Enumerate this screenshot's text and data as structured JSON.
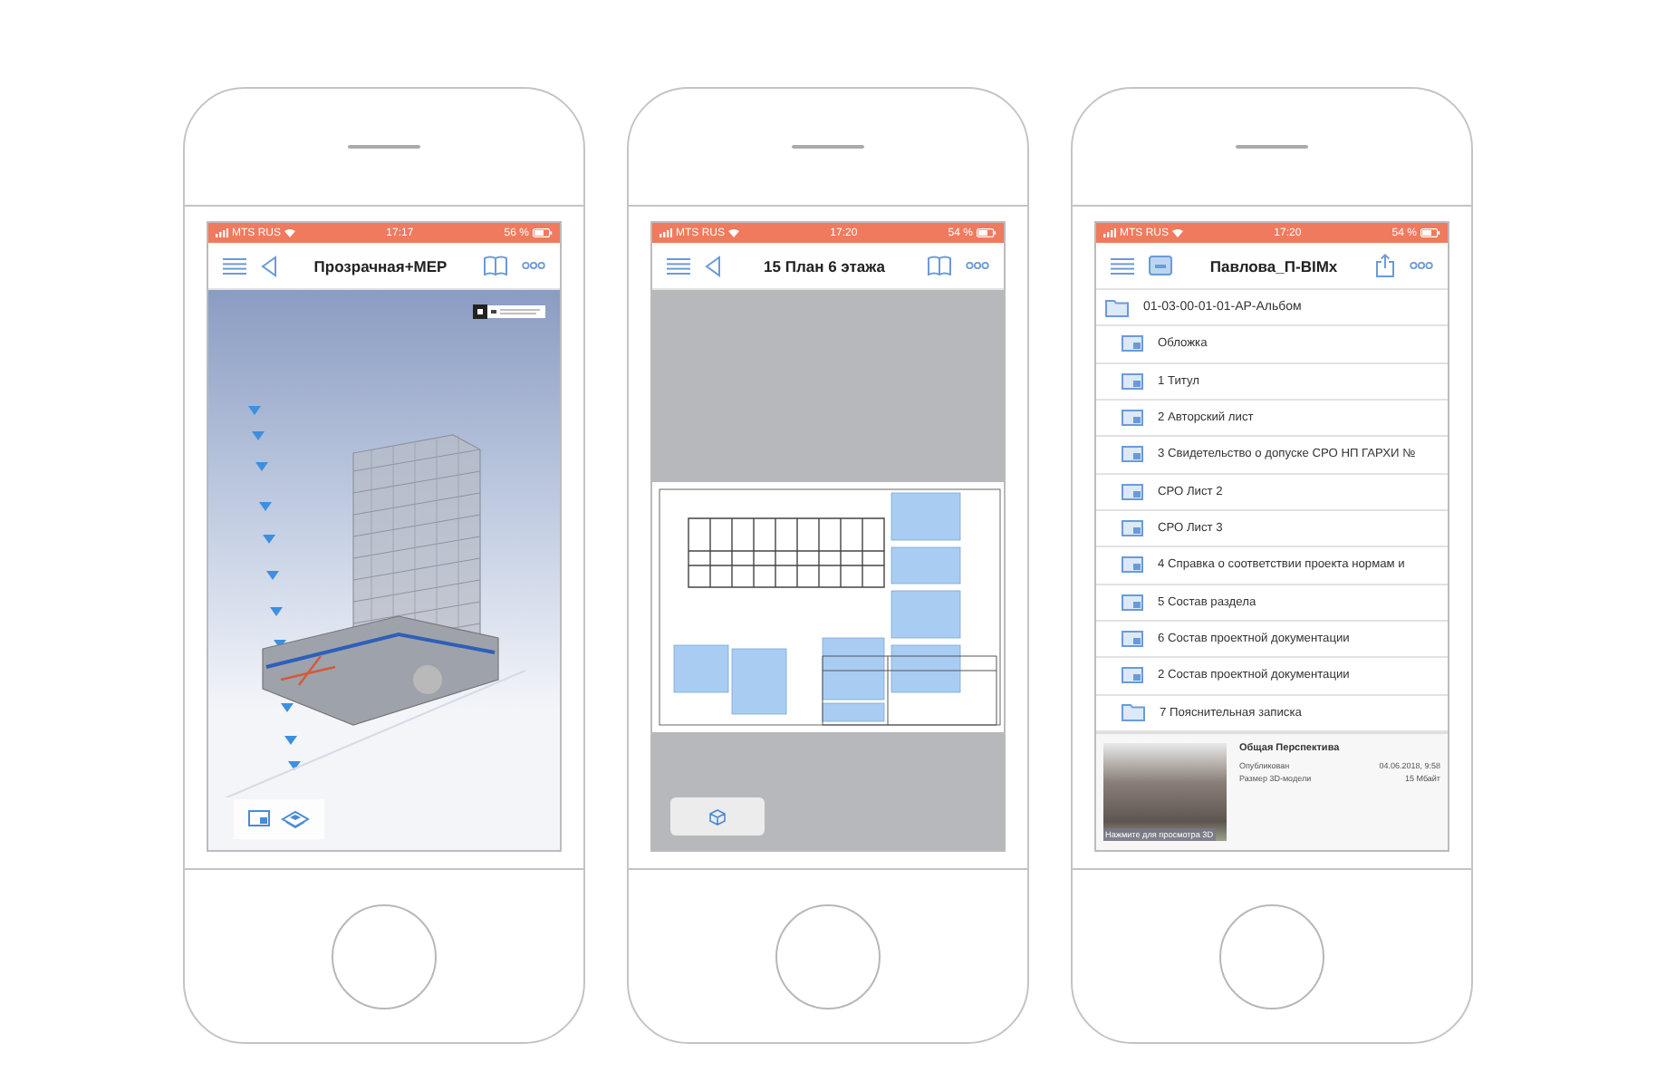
{
  "phones": [
    {
      "kind": "model",
      "status": {
        "carrier": "MTS RUS",
        "time": "17:17",
        "battery": "56 %"
      },
      "title": "Прозрачная+MEP"
    },
    {
      "kind": "sheet",
      "status": {
        "carrier": "MTS RUS",
        "time": "17:20",
        "battery": "54 %"
      },
      "title": "15 План 6 этажа"
    },
    {
      "kind": "browser",
      "status": {
        "carrier": "MTS RUS",
        "time": "17:20",
        "battery": "54 %"
      },
      "title": "Павлова_П-BIMx",
      "album": {
        "name": "01-03-00-01-01-АР-Альбом",
        "children": [
          {
            "kind": "sheet",
            "name": "Обложка"
          },
          {
            "kind": "sheet",
            "name": "1 Титул"
          },
          {
            "kind": "sheet",
            "name": "2 Авторский лист"
          },
          {
            "kind": "sheet",
            "name": "3 Свидетельство о допуске СРО НП ГАРХИ №"
          },
          {
            "kind": "sheet",
            "name": "СРО Лист 2"
          },
          {
            "kind": "sheet",
            "name": "СРО Лист 3"
          },
          {
            "kind": "sheet",
            "name": "4 Справка о соответствии проекта нормам и"
          },
          {
            "kind": "sheet",
            "name": "5 Состав раздела"
          },
          {
            "kind": "sheet",
            "name": "6 Состав проектной документации"
          },
          {
            "kind": "sheet",
            "name": "2 Состав проектной документации"
          },
          {
            "kind": "folder",
            "name": "7 Пояснительная записка"
          }
        ]
      },
      "preview": {
        "overlay": "Нажмите для просмотра 3D",
        "title": "Общая Перспектива",
        "rows": [
          {
            "label": "Опубликован",
            "value": "04.06.2018, 9:58"
          },
          {
            "label": "Размер 3D-модели",
            "value": "15 Мбайт"
          }
        ]
      }
    }
  ]
}
